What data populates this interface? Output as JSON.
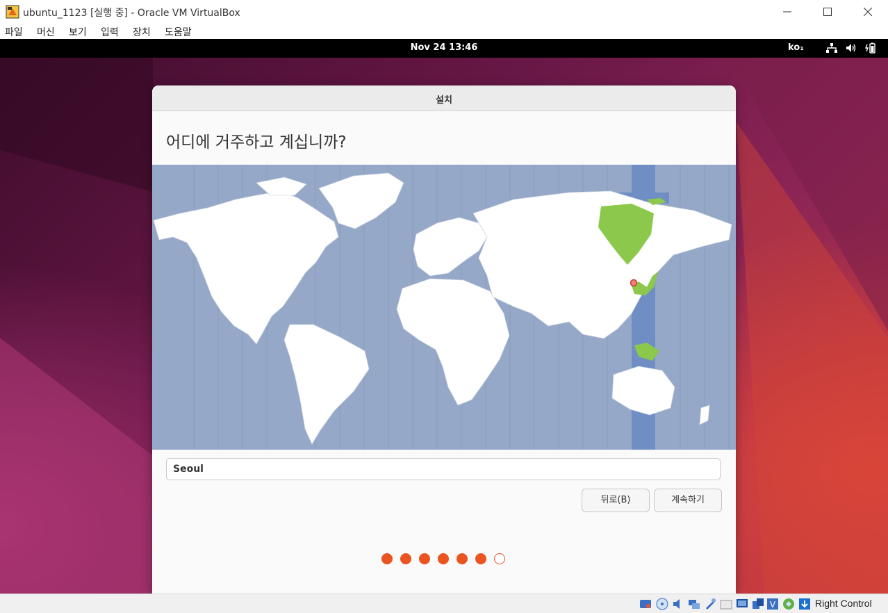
{
  "window": {
    "title": "ubuntu_1123 [실행 중] - Oracle VM VirtualBox",
    "minimize_glyph": "—",
    "maximize_glyph": "☐",
    "close_glyph": "✕"
  },
  "menu": [
    "파일",
    "머신",
    "보기",
    "입력",
    "장치",
    "도움말"
  ],
  "guest_topbar": {
    "datetime": "Nov 24  13:46",
    "keyboard_indicator": "ko₁",
    "icons": [
      "network-icon",
      "volume-icon",
      "battery-icon"
    ]
  },
  "installer": {
    "dialog_title": "설치",
    "question": "어디에 거주하고 계십니까?",
    "timezone_input_value": "Seoul",
    "back_button": "뒤로(B)",
    "continue_button": "계속하기",
    "progress": {
      "total_steps": 7,
      "completed_steps": 6
    }
  },
  "status_bar": {
    "host_key": "Right Control",
    "icons": [
      "hard-disk-icon",
      "optical-drive-icon",
      "audio-icon",
      "network-adapter-icon",
      "usb-icon",
      "shared-folder-icon",
      "display-icon",
      "recording-icon",
      "cpu-virtualization-icon",
      "mouse-integration-icon",
      "download-arrow-icon"
    ]
  },
  "colors": {
    "accent": "#e95420",
    "map_ocean": "#95a8c8",
    "map_selected_zone": "#6f8fc4",
    "map_highlight_land": "#8cc84b"
  }
}
